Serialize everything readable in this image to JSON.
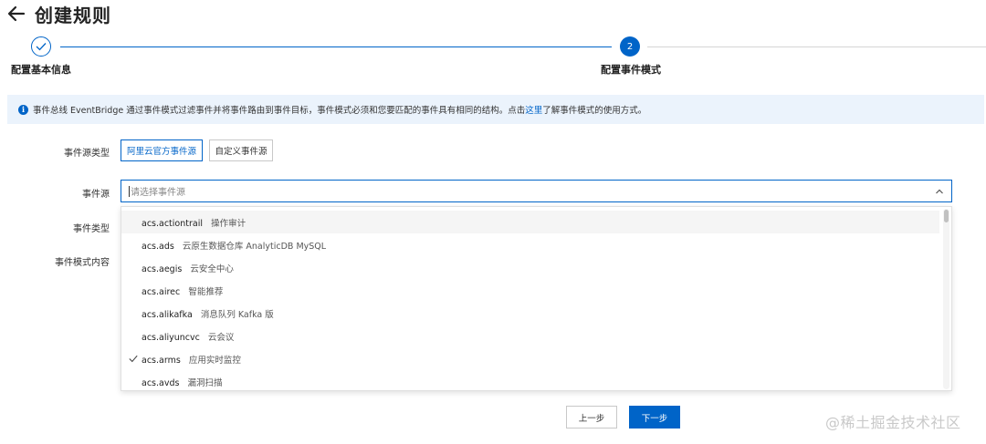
{
  "header": {
    "title": "创建规则"
  },
  "steps": [
    {
      "number": "1",
      "label": "配置基本信息",
      "status": "done"
    },
    {
      "number": "2",
      "label": "配置事件模式",
      "status": "active"
    }
  ],
  "info": {
    "text_before": "事件总线 EventBridge 通过事件模式过滤事件并将事件路由到事件目标，事件模式必须和您要匹配的事件具有相同的结构。点击",
    "link": "这里",
    "text_after": "了解事件模式的使用方式。"
  },
  "form": {
    "source_type_label": "事件源类型",
    "source_type_options": [
      "阿里云官方事件源",
      "自定义事件源"
    ],
    "source_type_selected": "阿里云官方事件源",
    "source_label": "事件源",
    "source_placeholder": "请选择事件源",
    "event_type_label": "事件类型",
    "pattern_label": "事件模式内容"
  },
  "dropdown": {
    "options": [
      {
        "code": "acs.actiontrail",
        "desc": "操作审计"
      },
      {
        "code": "acs.ads",
        "desc": "云原生数据仓库 AnalyticDB MySQL"
      },
      {
        "code": "acs.aegis",
        "desc": "云安全中心"
      },
      {
        "code": "acs.airec",
        "desc": "智能推荐"
      },
      {
        "code": "acs.alikafka",
        "desc": "消息队列 Kafka 版"
      },
      {
        "code": "acs.aliyuncvc",
        "desc": "云会议"
      },
      {
        "code": "acs.arms",
        "desc": "应用实时监控"
      },
      {
        "code": "acs.avds",
        "desc": "漏洞扫描"
      }
    ],
    "hovered_index": 0,
    "checked_code": "acs.arms"
  },
  "footer": {
    "prev_label": "上一步",
    "next_label": "下一步"
  },
  "watermark": "@稀土掘金技术社区",
  "colors": {
    "primary": "#0064c8",
    "banner_bg": "#ebf3fc"
  }
}
